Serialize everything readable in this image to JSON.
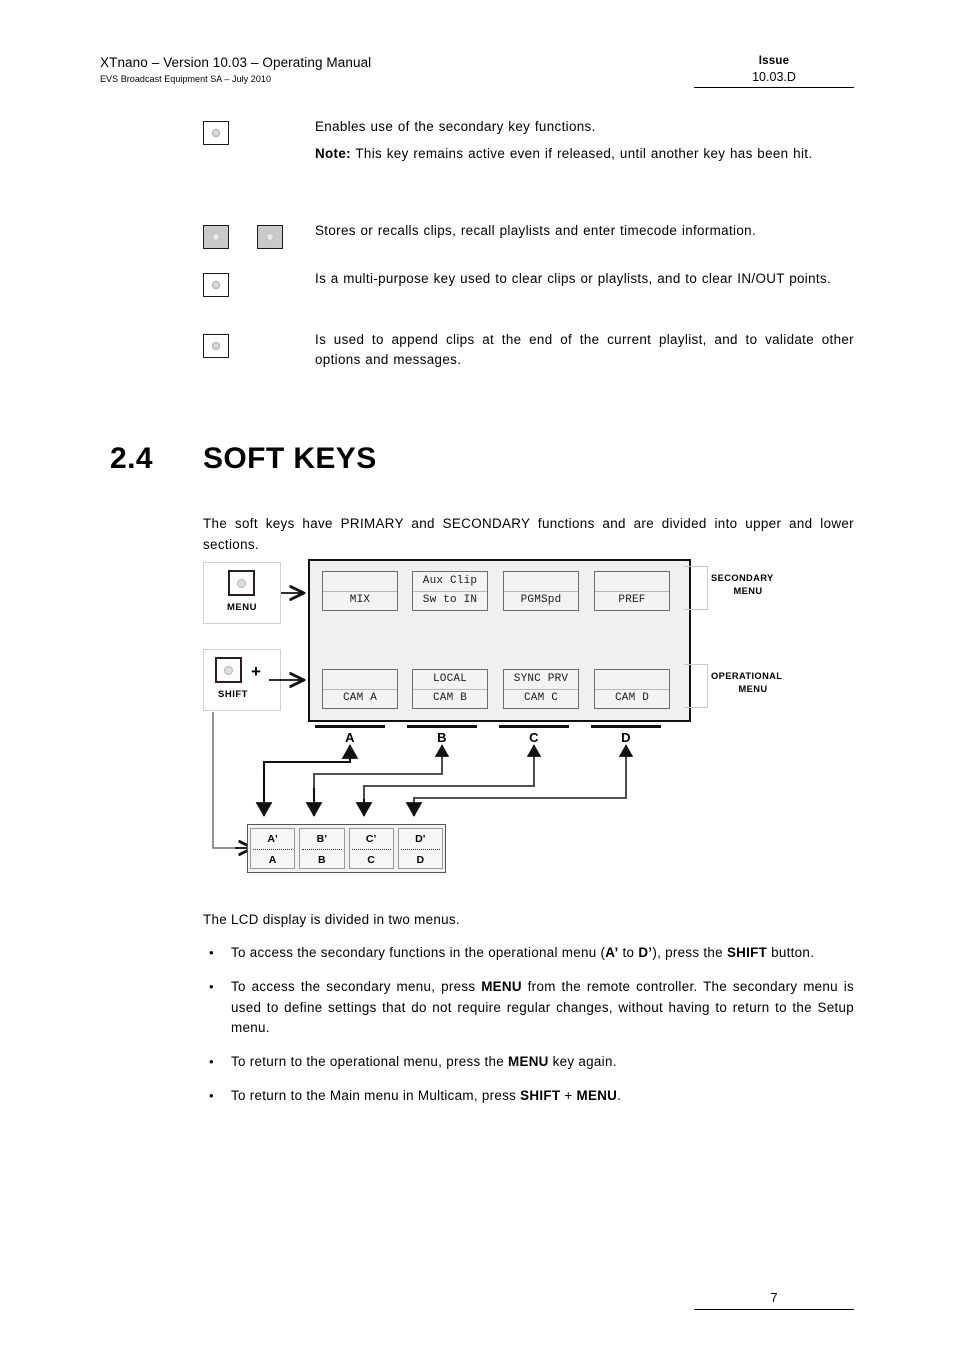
{
  "header": {
    "title": "XTnano – Version 10.03 – Operating Manual",
    "subtitle": "EVS Broadcast Equipment SA – July 2010",
    "issue_label": "Issue",
    "issue_value": "10.03.D"
  },
  "key_descriptions": [
    {
      "icon": "key-white-single",
      "paragraphs": [
        {
          "text": "Enables use of the secondary key functions."
        },
        {
          "bold_lead": "Note:",
          "text": " This key remains active even if released, until another key has been hit."
        }
      ]
    },
    {
      "icon": "key-gray-pair",
      "paragraphs": [
        {
          "text": "Stores or recalls clips, recall playlists and enter timecode information."
        }
      ]
    },
    {
      "icon": "key-white-single",
      "paragraphs": [
        {
          "text": "Is a multi-purpose key used to clear clips or playlists, and to clear IN/OUT points."
        }
      ]
    },
    {
      "icon": "key-white-single",
      "paragraphs": [
        {
          "text": "Is used to append clips at the end of the current playlist, and to validate other options and messages."
        }
      ]
    }
  ],
  "section": {
    "number": "2.4",
    "title": "SOFT KEYS",
    "intro": "The soft keys have PRIMARY and SECONDARY functions and are divided into upper and lower sections."
  },
  "diagram": {
    "menu_button_label": "MENU",
    "shift_button_label": "SHIFT",
    "plus_symbol": "+",
    "secondary_menu_label": "SECONDARY\nMENU",
    "secondary_menu_line1": "SECONDARY",
    "secondary_menu_line2": "MENU",
    "operational_menu_line1": "OPERATIONAL",
    "operational_menu_line2": "MENU",
    "lcd_cells": [
      {
        "secondary": "",
        "primary": "MIX"
      },
      {
        "secondary": "Aux Clip",
        "primary": "Sw to IN"
      },
      {
        "secondary": "",
        "primary": "PGMSpd"
      },
      {
        "secondary": "",
        "primary": "PREF"
      },
      {
        "secondary": "",
        "primary": "CAM A"
      },
      {
        "secondary": "LOCAL",
        "primary": "CAM B"
      },
      {
        "secondary": "SYNC PRV",
        "primary": "CAM C"
      },
      {
        "secondary": "",
        "primary": "CAM D"
      }
    ],
    "terminal_labels": [
      "A",
      "B",
      "C",
      "D"
    ],
    "keypad": [
      {
        "upper": "A'",
        "lower": "A"
      },
      {
        "upper": "B'",
        "lower": "B"
      },
      {
        "upper": "C'",
        "lower": "C"
      },
      {
        "upper": "D'",
        "lower": "D"
      }
    ]
  },
  "body": {
    "lead": "The LCD display is divided in two menus.",
    "bullet_marker": "•",
    "bullets": [
      [
        {
          "t": "To access the secondary functions in the operational menu ("
        },
        {
          "t": "A’",
          "b": true
        },
        {
          "t": " to "
        },
        {
          "t": "D’",
          "b": true
        },
        {
          "t": "), press the "
        },
        {
          "t": "SHIFT",
          "b": true
        },
        {
          "t": " button."
        }
      ],
      [
        {
          "t": "To access the secondary menu, press "
        },
        {
          "t": "MENU",
          "b": true
        },
        {
          "t": " from the remote controller. The secondary menu is used to define settings that do not require regular changes, without having to return to the Setup menu."
        }
      ],
      [
        {
          "t": "To return to the operational menu, press the "
        },
        {
          "t": "MENU",
          "b": true
        },
        {
          "t": " key again."
        }
      ],
      [
        {
          "t": "To return to the Main menu in Multicam, press "
        },
        {
          "t": "SHIFT",
          "b": true
        },
        {
          "t": " + "
        },
        {
          "t": "MENU",
          "b": true
        },
        {
          "t": "."
        }
      ]
    ]
  },
  "footer": {
    "page_number": "7"
  }
}
